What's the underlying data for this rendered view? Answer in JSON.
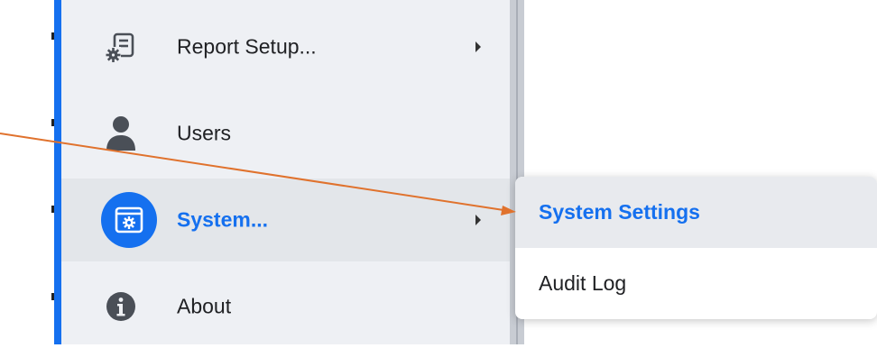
{
  "menu": {
    "items": [
      {
        "label": "Report Setup...",
        "icon": "report-gear-icon",
        "has_submenu": true
      },
      {
        "label": "Users",
        "icon": "user-icon",
        "has_submenu": false
      },
      {
        "label": "System...",
        "icon": "system-settings-icon",
        "has_submenu": true,
        "selected": true
      },
      {
        "label": "About",
        "icon": "info-icon",
        "has_submenu": false
      }
    ]
  },
  "submenu": {
    "items": [
      {
        "label": "System Settings",
        "highlighted": true
      },
      {
        "label": "Audit Log",
        "highlighted": false
      }
    ]
  },
  "colors": {
    "accent": "#1570ef",
    "annotation_arrow": "#e0722d",
    "menu_background": "#eef0f4"
  }
}
